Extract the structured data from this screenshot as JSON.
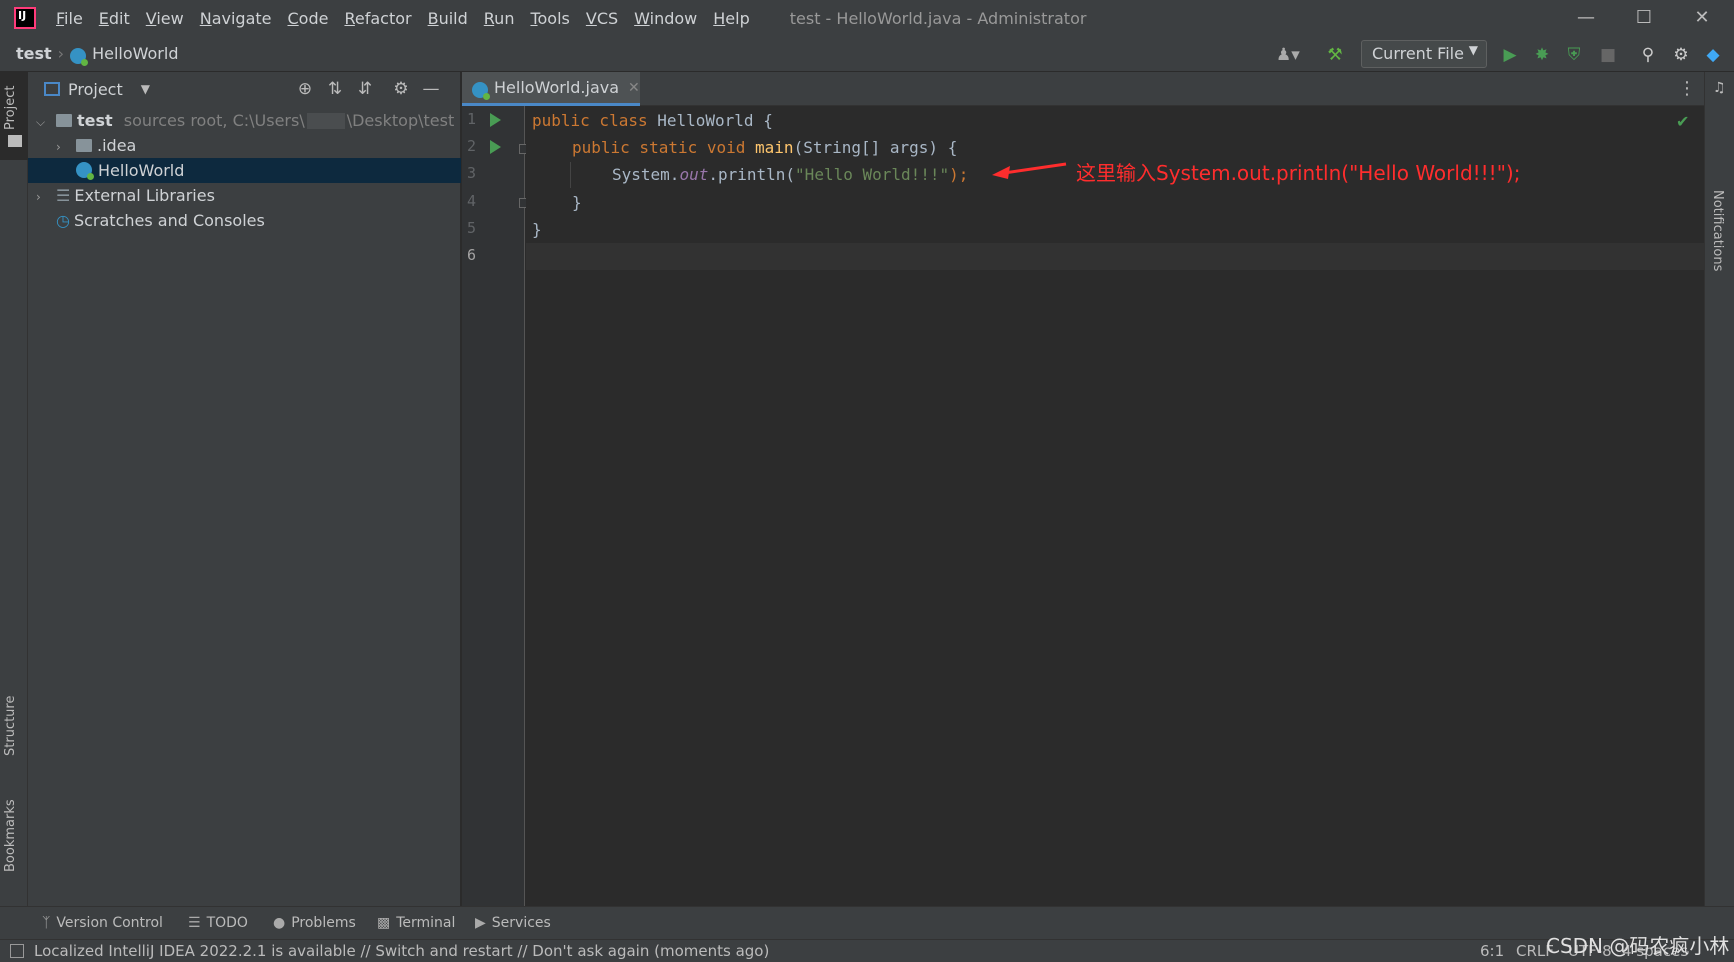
{
  "menu": {
    "items": [
      "File",
      "Edit",
      "View",
      "Navigate",
      "Code",
      "Refactor",
      "Build",
      "Run",
      "Tools",
      "VCS",
      "Window",
      "Help"
    ],
    "window_title": "test - HelloWorld.java - Administrator"
  },
  "nav": {
    "project": "test",
    "file": "HelloWorld",
    "run_config": "Current File"
  },
  "left_stripe": {
    "project": "Project",
    "structure": "Structure",
    "bookmarks": "Bookmarks"
  },
  "right_stripe": {
    "notifications": "Notifications"
  },
  "project_panel": {
    "title": "Project",
    "tree": [
      {
        "name": "test",
        "detail": "sources root,  C:\\Users\\",
        "detail2": "\\Desktop\\test"
      },
      {
        "name": ".idea"
      },
      {
        "name": "HelloWorld"
      },
      {
        "name": "External Libraries"
      },
      {
        "name": "Scratches and Consoles"
      }
    ]
  },
  "editor": {
    "tab": "HelloWorld.java",
    "line_numbers": [
      "1",
      "2",
      "3",
      "4",
      "5",
      "6"
    ],
    "code": {
      "l1_kw": "public class ",
      "l1_name": "HelloWorld",
      "l1_rest": " {",
      "l2_kw": "public static void ",
      "l2_fn": "main",
      "l2_rest": "(String[] args) {",
      "l3_a": "System.",
      "l3_field": "out",
      "l3_b": ".println(",
      "l3_str": "\"Hello World!!!\"",
      "l3_c": ");",
      "l4": "}",
      "l5": "}"
    },
    "annotation": "这里输入System.out.println(\"Hello World!!!\");"
  },
  "bottom_tools": [
    "Version Control",
    "TODO",
    "Problems",
    "Terminal",
    "Services"
  ],
  "status": {
    "message": "Localized IntelliJ IDEA 2022.2.1 is available // Switch and restart // Don't ask again (moments ago)",
    "position": "6:1",
    "line_sep": "CRLF",
    "encoding": "UTF-8",
    "indent": "4 spaces"
  },
  "watermark": "CSDN @码农疯小林",
  "colors": {
    "accent": "#4a88c7",
    "run": "#499c54",
    "annotation": "#ff2d2d"
  }
}
